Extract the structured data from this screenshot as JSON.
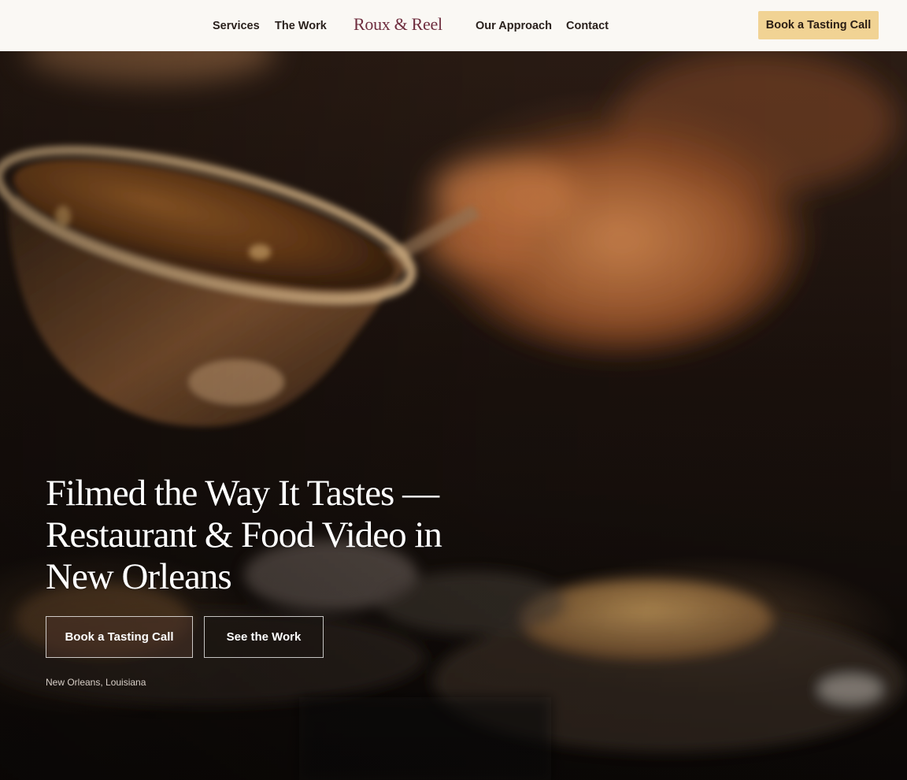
{
  "header": {
    "brand": "Roux & Reel",
    "nav": {
      "services": "Services",
      "work": "The Work",
      "approach": "Our Approach",
      "contact": "Contact"
    },
    "cta": "Book a Tasting Call"
  },
  "hero": {
    "title": "Filmed the Way It Tastes — Restaurant & Food Video in New Orleans",
    "primary_cta": "Book a Tasting Call",
    "secondary_cta": "See the Work",
    "location": "New Orleans, Louisiana"
  },
  "colors": {
    "header_bg": "#faf8f4",
    "brand": "#6e2d3e",
    "cta_bg": "#f1d394",
    "nav_text": "#2a211d"
  }
}
